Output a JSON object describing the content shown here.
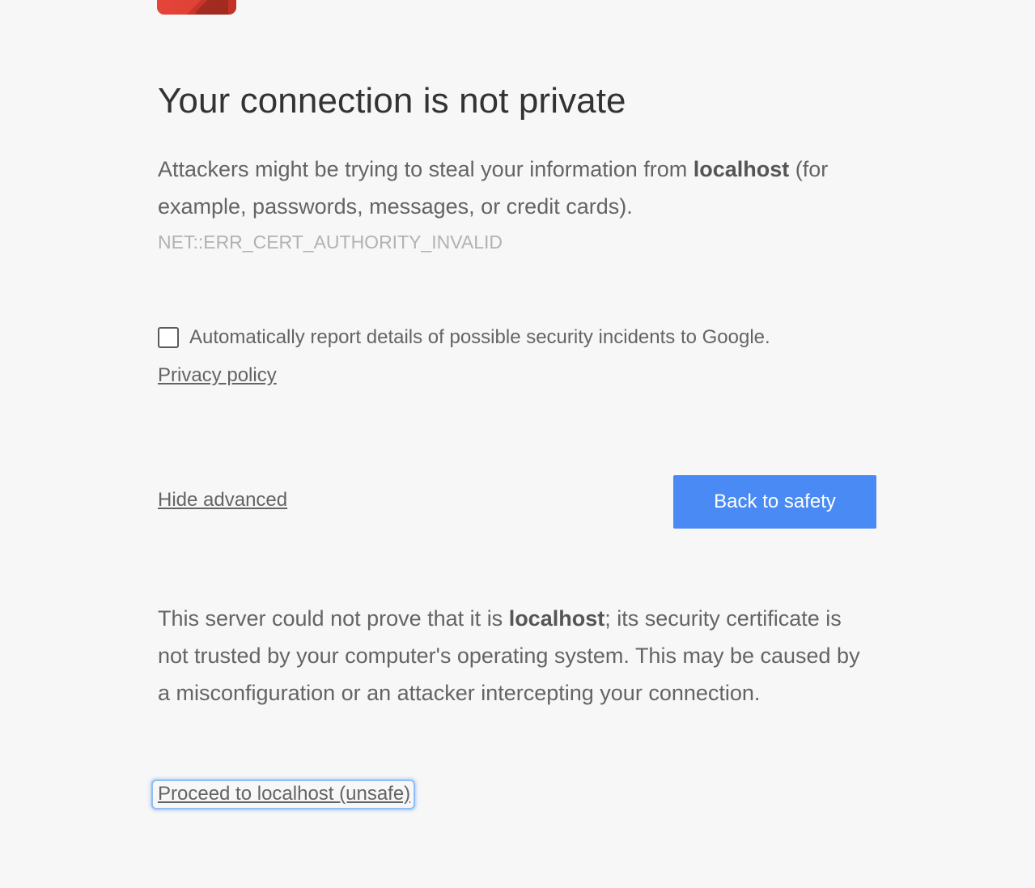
{
  "icon": {
    "name": "warning-lock-icon",
    "color": "#e8453c"
  },
  "heading": {
    "title": "Your connection is not private"
  },
  "main_message": {
    "prefix": "Attackers might be trying to steal your information from ",
    "host": "localhost",
    "suffix": " (for example, passwords, messages, or credit cards)."
  },
  "error_code": "NET::ERR_CERT_AUTHORITY_INVALID",
  "report": {
    "checked": false,
    "label": "Automatically report details of possible security incidents to Google."
  },
  "privacy_link": "Privacy policy",
  "advanced_toggle": "Hide advanced",
  "primary_button": {
    "label": "Back to safety",
    "color": "#4a8af4"
  },
  "details": {
    "prefix": "This server could not prove that it is ",
    "host": "localhost",
    "suffix": "; its security certificate is not trusted by your computer's operating system. This may be caused by a misconfiguration or an attacker intercepting your connection."
  },
  "proceed_link": "Proceed to localhost (unsafe)"
}
